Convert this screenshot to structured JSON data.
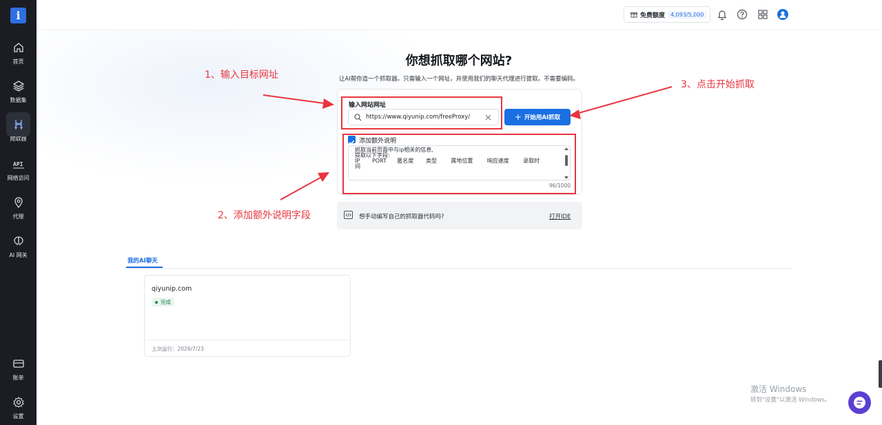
{
  "sidebar": {
    "logo": "i",
    "items": [
      {
        "label": "首页",
        "icon": "home-icon"
      },
      {
        "label": "数据集",
        "icon": "layers-icon"
      },
      {
        "label": "爬取器",
        "icon": "scraper-icon"
      },
      {
        "label": "网络访问",
        "icon": "api-icon"
      },
      {
        "label": "代理",
        "icon": "location-pin-icon"
      },
      {
        "label": "AI 网关",
        "icon": "brain-icon"
      }
    ],
    "bottom_items": [
      {
        "label": "账单",
        "icon": "wallet-icon"
      },
      {
        "label": "设置",
        "icon": "gear-icon"
      }
    ]
  },
  "topbar": {
    "credit_label": "免费额度",
    "credit_value": "4,093/5,000"
  },
  "hero": {
    "title": "你想抓取哪个网站?",
    "subtitle": "让AI帮你造一个抓取器。只需输入一个网址，并使用我们的聊天代理进行提取。不需要编码。"
  },
  "form": {
    "url_label": "输入网站网址",
    "url_value": "https://www.qiyunip.com/freeProxy/",
    "start_button": "开始用AI抓取",
    "extra_label": "添加额外说明",
    "desc_lines": [
      "抓取当前页面中与ip相关的信息,",
      "提取以下字段:",
      "IP       PORT      匿名度       类型        属地位置        响应速度        录取时",
      "间"
    ],
    "counter": "96/1000"
  },
  "annotations": {
    "step1": "1、输入目标网址",
    "step2": "2、添加额外说明字段",
    "step3": "3、点击开始抓取",
    "color": "#e8353f"
  },
  "ide": {
    "text": "想手动编写自己的抓取器代码吗?",
    "link": "打开IDE"
  },
  "chats": {
    "tab": "我的AI聊天",
    "items": [
      {
        "title": "qiyunip.com",
        "status": "完成",
        "last_run": "上次运行：2026/7/23"
      }
    ]
  },
  "watermark": {
    "title": "激活 Windows",
    "subtitle": "转到\"设置\"以激活 Windows。"
  },
  "colors": {
    "accent": "#1a6fe3",
    "sidebar_bg": "#1b1d22",
    "success": "#1f7a48"
  }
}
